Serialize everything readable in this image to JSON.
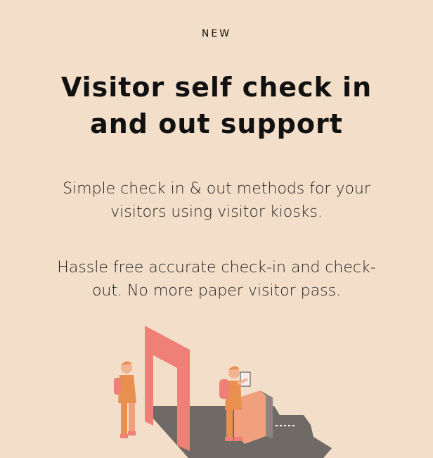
{
  "badge": "NEW",
  "heading": "Visitor self check in and out support",
  "paragraphs": [
    "Simple check in & out methods for your visitors using visitor kiosks.",
    "Hassle free accurate check-in and check-out. No more paper visitor pass."
  ],
  "colors": {
    "background": "#f3dfc9",
    "doorway": "#ef8077",
    "shadow": "#6f6a66",
    "person": "#e98f4f",
    "kiosk": "#f0a07d",
    "skin": "#f2b394"
  }
}
